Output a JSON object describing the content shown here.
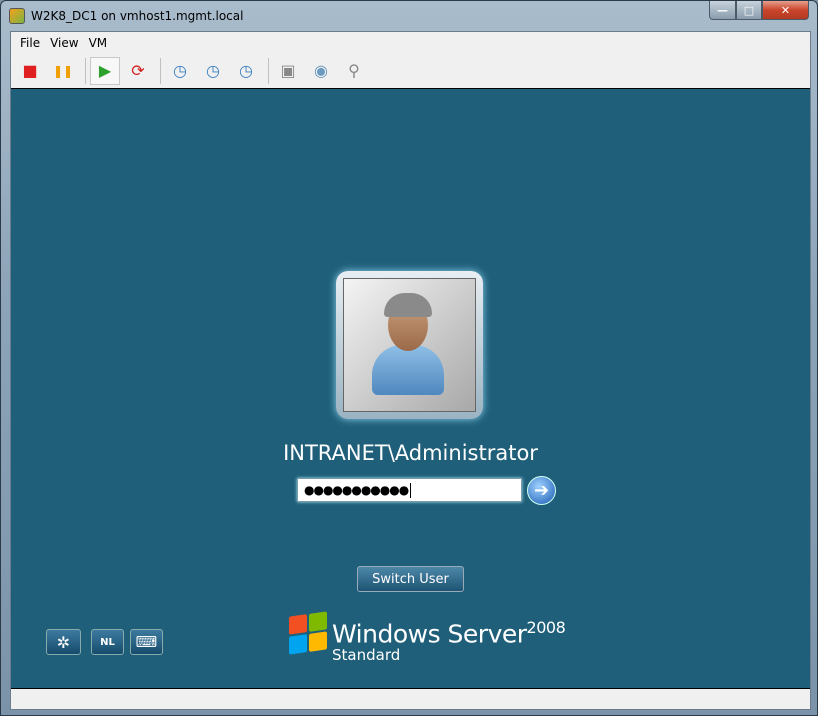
{
  "window": {
    "title": "W2K8_DC1 on vmhost1.mgmt.local",
    "controls": {
      "minimize": "—",
      "maximize": "□",
      "close": "✕"
    }
  },
  "menu": [
    "File",
    "View",
    "VM"
  ],
  "toolbar": [
    {
      "name": "power-off",
      "glyph": "■",
      "color": "#e02020"
    },
    {
      "name": "suspend",
      "glyph": "❚❚",
      "color": "#f0a000"
    },
    {
      "name": "power-on",
      "glyph": "▶",
      "color": "#2ea02e"
    },
    {
      "name": "reset",
      "glyph": "⟳",
      "color": "#d02020"
    },
    {
      "name": "take-snapshot",
      "glyph": "◷",
      "color": "#3a7fc0"
    },
    {
      "name": "revert-snapshot",
      "glyph": "◷",
      "color": "#3a7fc0"
    },
    {
      "name": "manage-snapshots",
      "glyph": "◷",
      "color": "#3a7fc0"
    },
    {
      "name": "floppy-settings",
      "glyph": "▣",
      "color": "#888888"
    },
    {
      "name": "cd-settings",
      "glyph": "◉",
      "color": "#6a9ac0"
    },
    {
      "name": "usb-settings",
      "glyph": "⚲",
      "color": "#888888"
    }
  ],
  "login": {
    "username": "INTRANET\\Administrator",
    "password_mask": "●●●●●●●●●●●",
    "switch_user": "Switch User",
    "go_glyph": "➔"
  },
  "bottom": {
    "language": "NL",
    "ease_glyph": "✲",
    "keyboard_glyph": "⌨"
  },
  "brand": {
    "line1": "Windows Server",
    "version": "2008",
    "edition": "Standard",
    "flag_colors": [
      "#f25022",
      "#7fba00",
      "#00a4ef",
      "#ffb900"
    ]
  },
  "colors": {
    "desktop": "#1f5f7a"
  }
}
